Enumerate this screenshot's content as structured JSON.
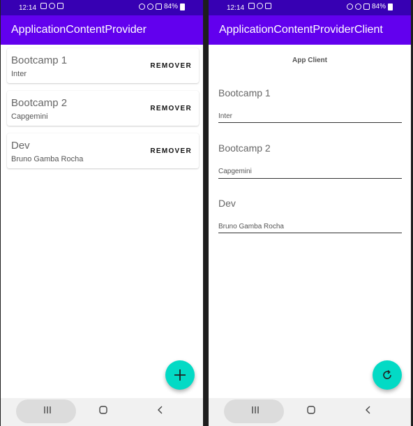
{
  "status_bar": {
    "time": "12:14",
    "battery": "84%"
  },
  "left_app": {
    "title": "ApplicationContentProvider",
    "items": [
      {
        "title": "Bootcamp 1",
        "subtitle": "Inter",
        "action": "REMOVER"
      },
      {
        "title": "Bootcamp 2",
        "subtitle": "Capgemini",
        "action": "REMOVER"
      },
      {
        "title": "Dev",
        "subtitle": "Bruno Gamba Rocha",
        "action": "REMOVER"
      }
    ],
    "fab_icon": "plus-icon"
  },
  "right_app": {
    "title": "ApplicationContentProviderClient",
    "header": "App Client",
    "items": [
      {
        "title": "Bootcamp 1",
        "subtitle": "Inter"
      },
      {
        "title": "Bootcamp 2",
        "subtitle": "Capgemini"
      },
      {
        "title": "Dev",
        "subtitle": "Bruno Gamba Rocha"
      }
    ],
    "fab_icon": "refresh-icon"
  },
  "navigation_bar": {
    "icons": [
      "recent-apps-icon",
      "home-icon",
      "back-icon"
    ]
  },
  "colors": {
    "app_bar": "#6200ee",
    "status_bar": "#3700b3",
    "fab": "#03dac5"
  }
}
